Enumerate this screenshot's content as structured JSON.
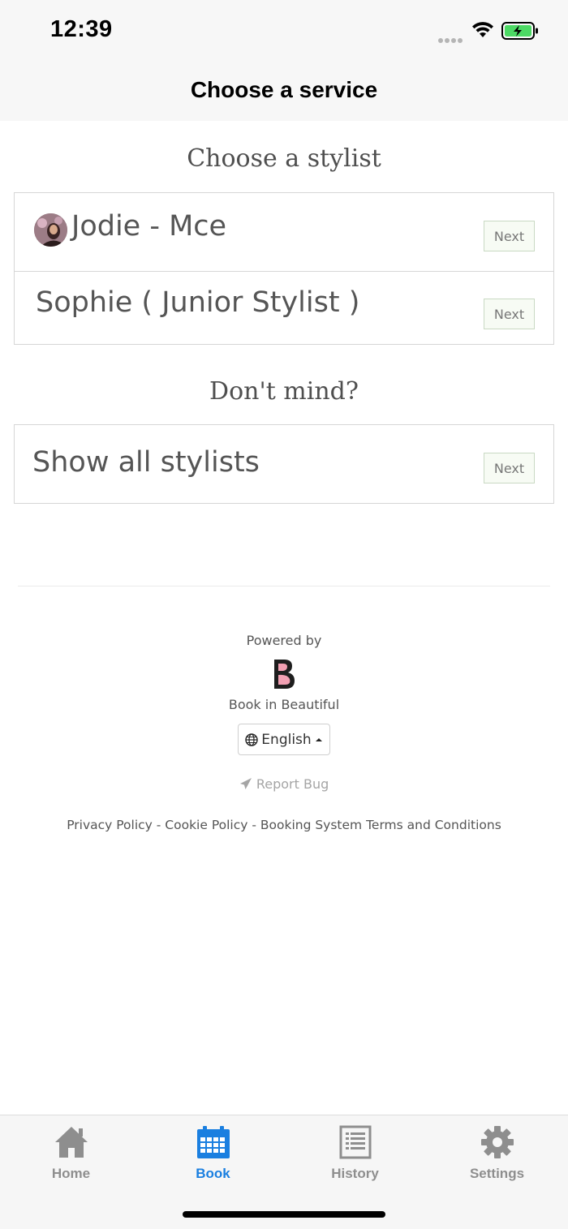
{
  "status_bar": {
    "time": "12:39"
  },
  "header": {
    "title": "Choose a service"
  },
  "stylist_section": {
    "heading": "Choose a stylist",
    "stylists": [
      {
        "name": "Jodie - Mce",
        "next_label": "Next",
        "has_avatar": true
      },
      {
        "name": "Sophie ( Junior Stylist )",
        "next_label": "Next",
        "has_avatar": false
      }
    ]
  },
  "dont_mind_section": {
    "heading": "Don't mind?",
    "option": {
      "label": "Show all stylists",
      "next_label": "Next"
    }
  },
  "footer": {
    "powered_by": "Powered by",
    "brand_name": "Book in Beautiful",
    "language": "English",
    "report_bug": "Report Bug",
    "privacy_policy": "Privacy Policy",
    "cookie_policy": "Cookie Policy",
    "terms": "Booking System Terms and Conditions",
    "separator": " - "
  },
  "tab_bar": {
    "tabs": [
      {
        "label": "Home",
        "icon": "home-icon",
        "active": false
      },
      {
        "label": "Book",
        "icon": "calendar-icon",
        "active": true
      },
      {
        "label": "History",
        "icon": "list-document-icon",
        "active": false
      },
      {
        "label": "Settings",
        "icon": "gear-icon",
        "active": false
      }
    ]
  },
  "colors": {
    "active_tab": "#1a7fe0",
    "inactive_tab": "#8e8e8e",
    "battery_fill": "#4cd964",
    "logo_pink": "#f2a0b3"
  }
}
